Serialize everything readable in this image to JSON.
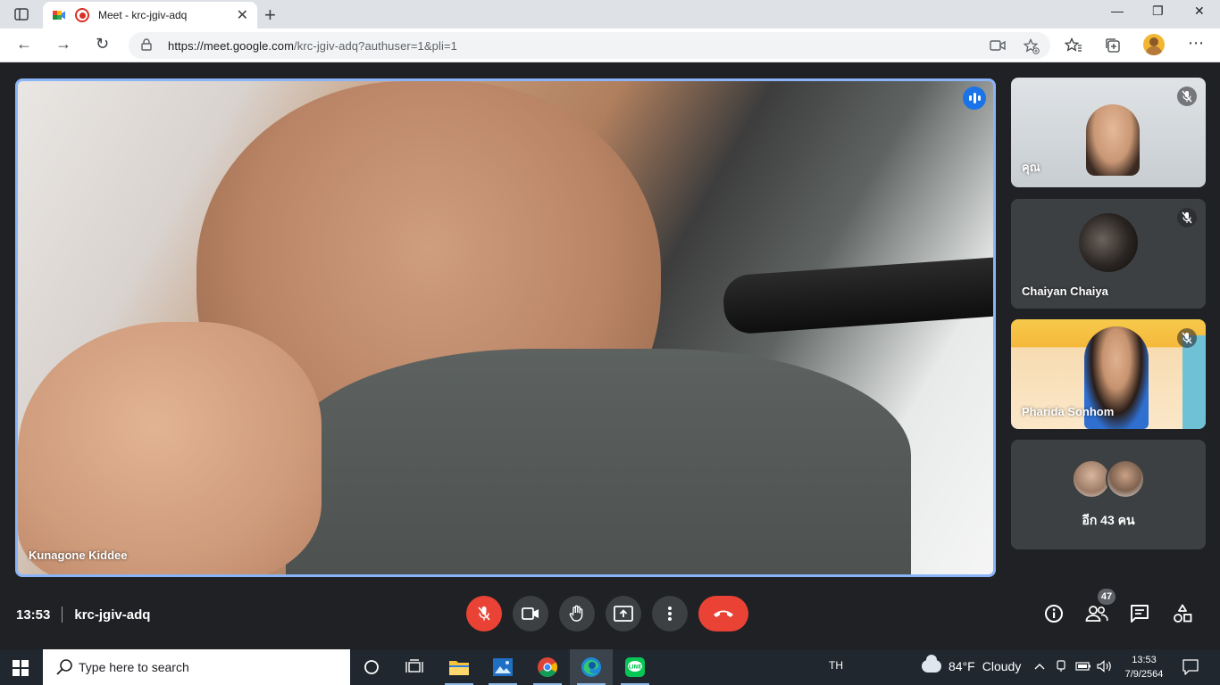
{
  "browser": {
    "tab_title": "Meet - krc-jgiv-adq",
    "tab_close": "✕",
    "new_tab": "+",
    "url_host": "https://meet.google.com",
    "url_path": "/krc-jgiv-adq?authuser=1&pli=1",
    "window_controls": {
      "minimize": "—",
      "restore": "❐",
      "close": "✕"
    },
    "nav": {
      "back": "←",
      "forward": "→",
      "reload": "↻"
    },
    "menu": "⋯"
  },
  "meet": {
    "main_speaker": "Kunagone Kiddee",
    "participants": [
      {
        "name": "คุณ",
        "muted": true
      },
      {
        "name": "Chaiyan Chaiya",
        "muted": true
      },
      {
        "name": "Pharida Sonhom",
        "muted": true
      }
    ],
    "others_label": "อีก 43 คน",
    "time": "13:53",
    "meeting_code": "krc-jgiv-adq",
    "people_count": "47"
  },
  "taskbar": {
    "search_placeholder": "Type here to search",
    "lang": "TH",
    "weather_temp": "84°F",
    "weather_desc": "Cloudy",
    "clock_time": "13:53",
    "clock_date": "7/9/2564"
  },
  "colors": {
    "meet_bg": "#202124",
    "tile_bg": "#3c4043",
    "accent_blue": "#1a73e8",
    "speaking_border": "#8ab4f8",
    "end_call_red": "#ea4335"
  }
}
